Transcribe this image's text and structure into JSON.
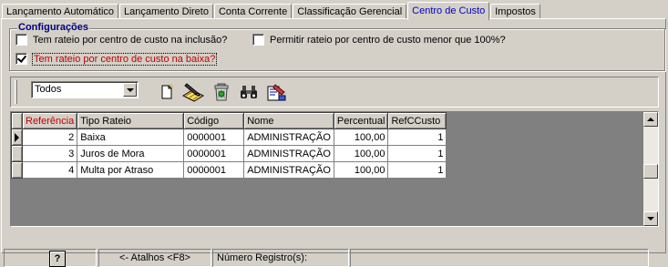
{
  "tabs": [
    {
      "label": "Lançamento Automático",
      "active": false
    },
    {
      "label": "Lançamento Direto",
      "active": false
    },
    {
      "label": "Conta Corrente",
      "active": false
    },
    {
      "label": "Classificação Gerencial",
      "active": false
    },
    {
      "label": "Centro de Custo",
      "active": true
    },
    {
      "label": "Impostos",
      "active": false
    }
  ],
  "config": {
    "title": "Configurações",
    "opt_inclusao": "Tem rateio por centro de custo na inclusão?",
    "opt_menor100": "Permitir rateio por centro de custo menor que 100%?",
    "opt_baixa": "Tem rateio por centro de custo na baixa?"
  },
  "toolbar": {
    "filter_value": "Todos",
    "icons": [
      "new-document-icon",
      "edit-icon",
      "delete-bin-icon",
      "binoculars-search-icon",
      "report-icon"
    ]
  },
  "grid": {
    "columns": [
      "Referência",
      "Tipo Rateio",
      "Código",
      "Nome",
      "Percentual",
      "RefCCusto"
    ],
    "rows": [
      {
        "ref": "2",
        "tipo": "Baixa",
        "codigo": "0000001",
        "nome": "ADMINISTRAÇÃO",
        "percentual": "100,00",
        "refccusto": "1"
      },
      {
        "ref": "3",
        "tipo": "Juros de Mora",
        "codigo": "0000001",
        "nome": "ADMINISTRAÇÃO",
        "percentual": "100,00",
        "refccusto": "1"
      },
      {
        "ref": "4",
        "tipo": "Multa por Atraso",
        "codigo": "0000001",
        "nome": "ADMINISTRAÇÃO",
        "percentual": "100,00",
        "refccusto": "1"
      }
    ]
  },
  "status": {
    "help": "?",
    "shortcuts": "<- Atalhos <F8>",
    "records": "Número Registro(s):"
  },
  "colors": {
    "accent": "#0000c8",
    "highlight": "#c00000",
    "group_title": "#00007f"
  }
}
